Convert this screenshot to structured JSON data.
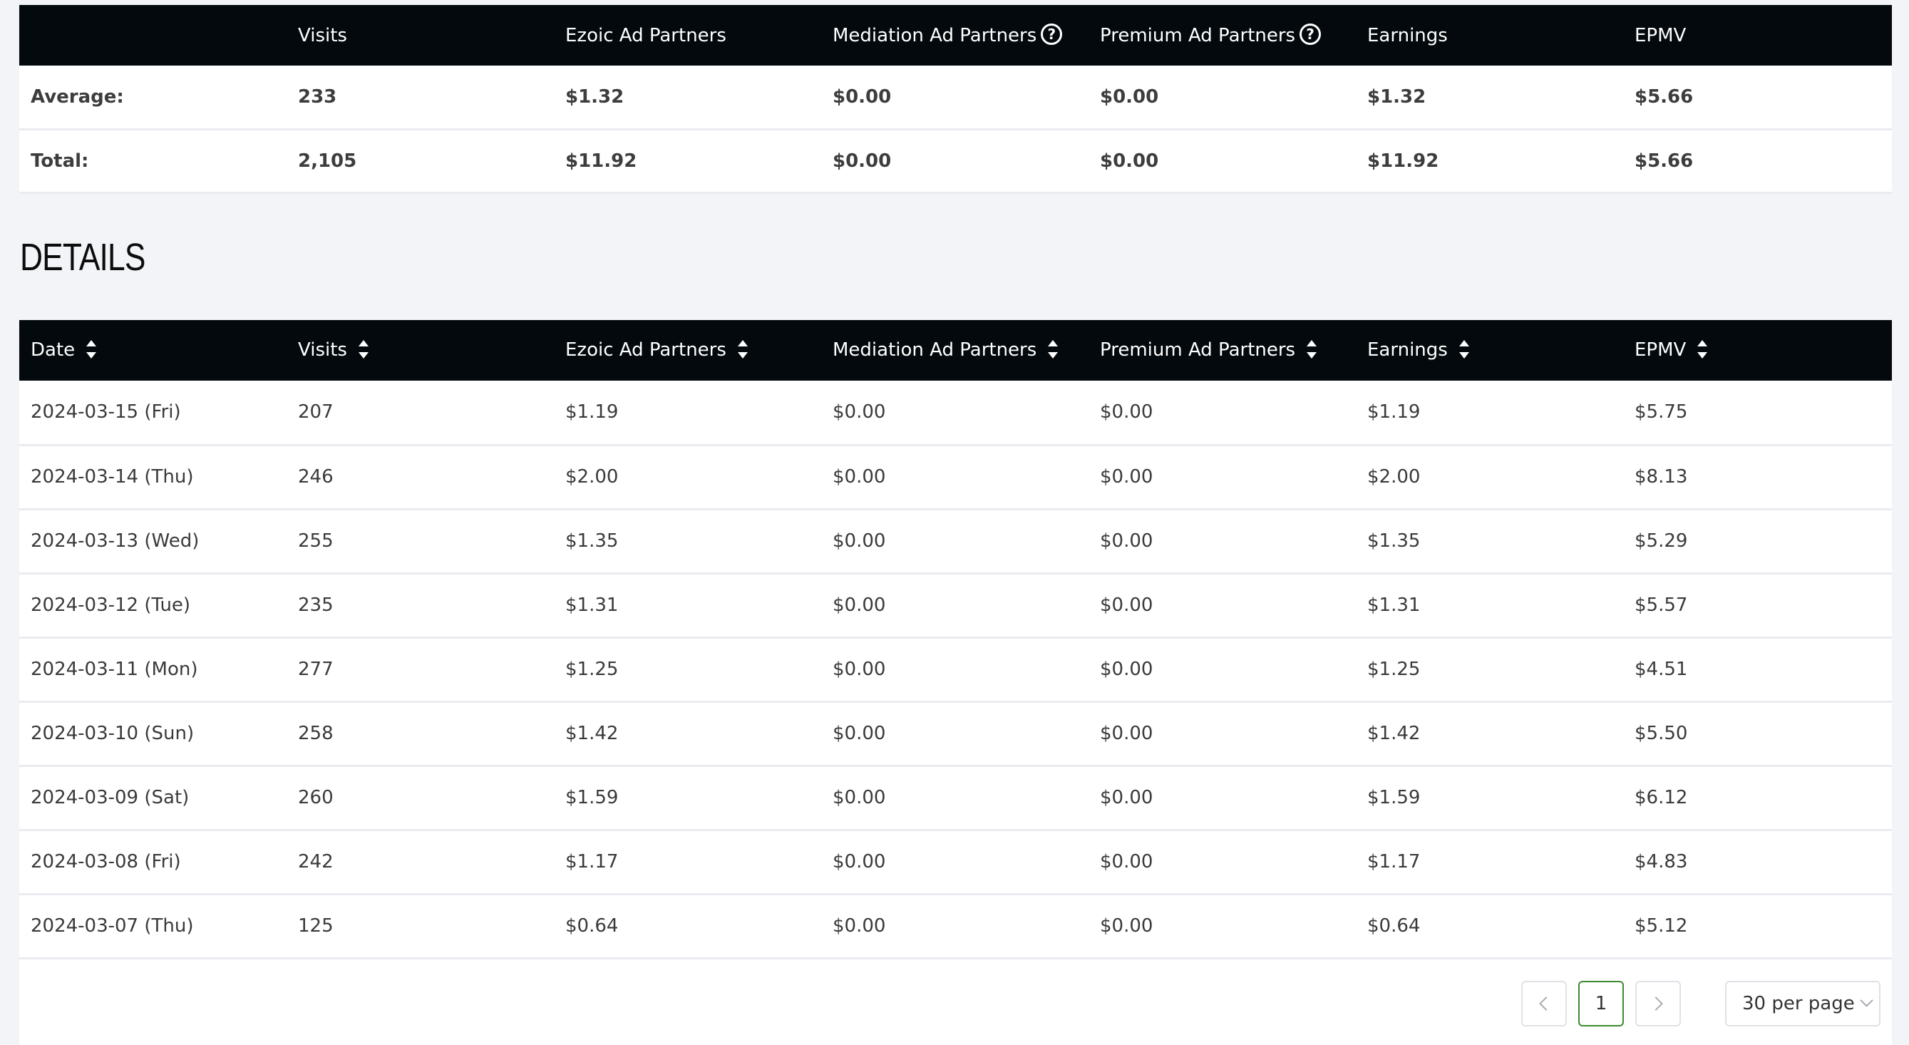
{
  "summary": {
    "headers": [
      "",
      "Visits",
      "Ezoic Ad Partners",
      "Mediation Ad Partners",
      "Premium Ad Partners",
      "Earnings",
      "EPMV"
    ],
    "help_icon": "question-circle-icon",
    "rows": [
      [
        "Average:",
        "233",
        "$1.32",
        "$0.00",
        "$0.00",
        "$1.32",
        "$5.66"
      ],
      [
        "Total:",
        "2,105",
        "$11.92",
        "$0.00",
        "$0.00",
        "$11.92",
        "$5.66"
      ]
    ]
  },
  "details": {
    "title": "DETAILS",
    "headers": [
      "Date",
      "Visits",
      "Ezoic Ad Partners",
      "Mediation Ad Partners",
      "Premium Ad Partners",
      "Earnings",
      "EPMV"
    ],
    "rows": [
      [
        "2024-03-15 (Fri)",
        "207",
        "$1.19",
        "$0.00",
        "$0.00",
        "$1.19",
        "$5.75"
      ],
      [
        "2024-03-14 (Thu)",
        "246",
        "$2.00",
        "$0.00",
        "$0.00",
        "$2.00",
        "$8.13"
      ],
      [
        "2024-03-13 (Wed)",
        "255",
        "$1.35",
        "$0.00",
        "$0.00",
        "$1.35",
        "$5.29"
      ],
      [
        "2024-03-12 (Tue)",
        "235",
        "$1.31",
        "$0.00",
        "$0.00",
        "$1.31",
        "$5.57"
      ],
      [
        "2024-03-11 (Mon)",
        "277",
        "$1.25",
        "$0.00",
        "$0.00",
        "$1.25",
        "$4.51"
      ],
      [
        "2024-03-10 (Sun)",
        "258",
        "$1.42",
        "$0.00",
        "$0.00",
        "$1.42",
        "$5.50"
      ],
      [
        "2024-03-09 (Sat)",
        "260",
        "$1.59",
        "$0.00",
        "$0.00",
        "$1.59",
        "$6.12"
      ],
      [
        "2024-03-08 (Fri)",
        "242",
        "$1.17",
        "$0.00",
        "$0.00",
        "$1.17",
        "$4.83"
      ],
      [
        "2024-03-07 (Thu)",
        "125",
        "$0.64",
        "$0.00",
        "$0.00",
        "$0.64",
        "$5.12"
      ]
    ]
  },
  "pagination": {
    "current_page": "1",
    "per_page": "30 per page"
  },
  "colors": {
    "header_bg": "#04090d",
    "page_bg": "#f3f4f7",
    "active_page_border": "#3c8b2f"
  }
}
